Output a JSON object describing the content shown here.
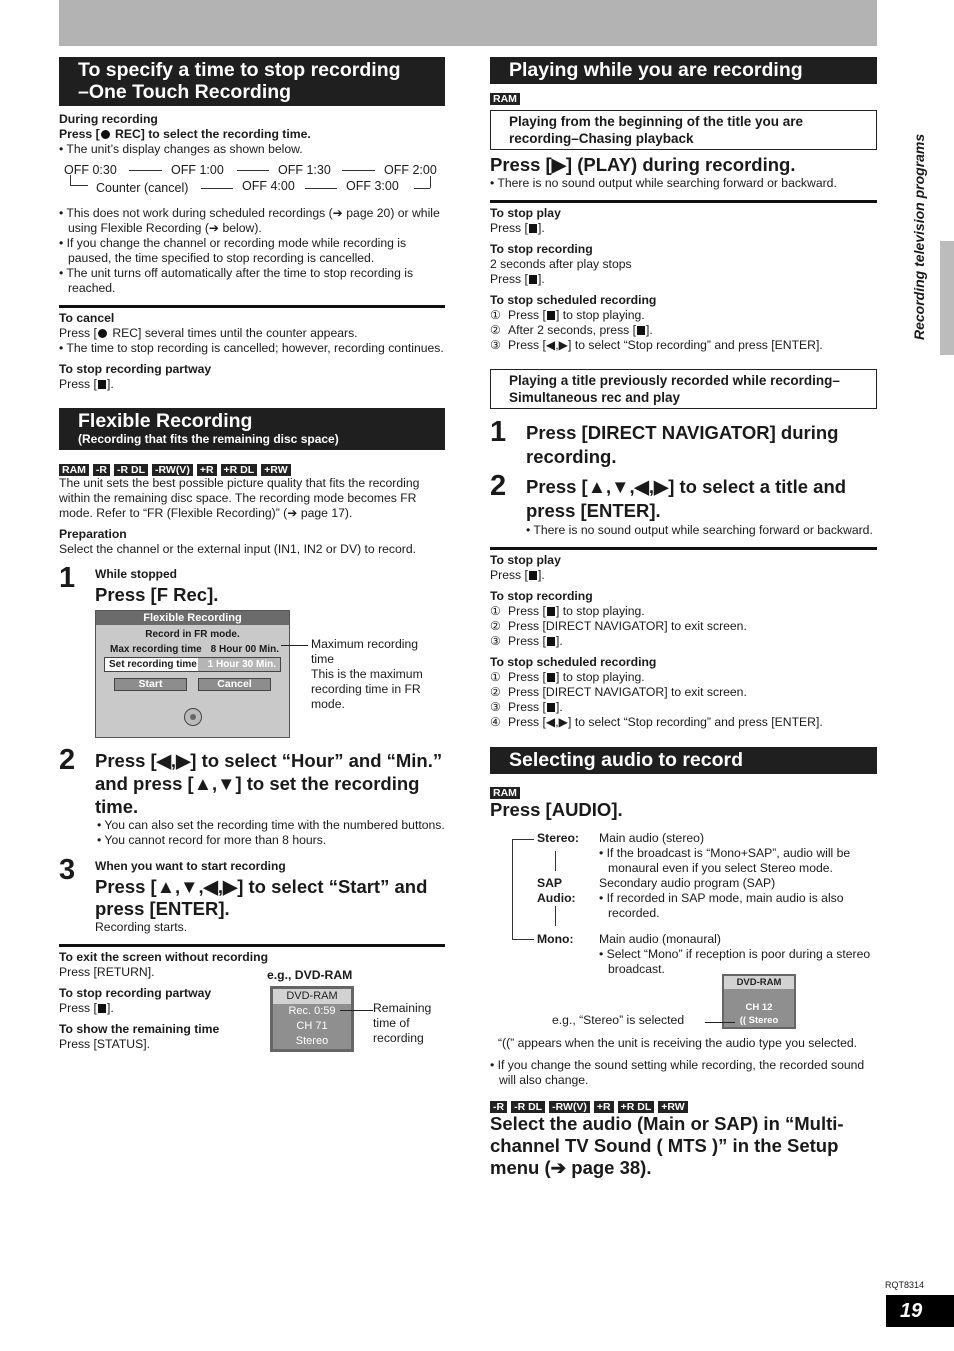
{
  "page": {
    "side_label": "Recording television programs",
    "doc_code": "RQT8314",
    "page_number": "19"
  },
  "one_touch": {
    "title_line1": "To specify a time to stop recording",
    "title_line2": "–One Touch Recording",
    "during": "During recording",
    "press_pre": "Press [",
    "press_post": " REC] to select the recording time.",
    "display_note": "• The unit’s display changes as shown below.",
    "cycle": {
      "off_030": "OFF 0:30",
      "off_100": "OFF 1:00",
      "off_130": "OFF 1:30",
      "off_200": "OFF 2:00",
      "counter": "Counter (cancel)",
      "off_400": "OFF 4:00",
      "off_300": "OFF 3:00"
    },
    "notes": [
      "• This does not work during scheduled recordings (➔ page 20) or while using Flexible Recording (➔ below).",
      "• If you change the channel or recording mode while recording is paused, the time specified to stop recording is cancelled.",
      "• The unit turns off automatically after the time to stop recording is reached."
    ],
    "cancel_head": "To cancel",
    "cancel_pre": "Press [",
    "cancel_post": " REC] several times until the counter appears.",
    "cancel_note": "• The time to stop recording is cancelled; however, recording continues.",
    "partway_head": "To stop recording partway",
    "press_open": "Press [",
    "press_close": "]."
  },
  "flexible": {
    "title": "Flexible Recording",
    "subtitle": "(Recording that fits the remaining disc space)",
    "discs": [
      "RAM",
      "-R",
      "-R DL",
      "-RW(V)",
      "+R",
      "+R DL",
      "+RW"
    ],
    "intro": "The unit sets the best possible picture quality that fits the recording within the remaining disc space. The recording mode becomes FR mode. Refer to “FR (Flexible Recording)” (➔ page 17).",
    "prep_head": "Preparation",
    "prep_text": "Select the channel or the external input (IN1, IN2 or DV) to record.",
    "step1_num": "1",
    "step1_pre": "While stopped",
    "step1_main": "Press [F Rec].",
    "osd": {
      "title": "Flexible Recording",
      "mode": "Record in FR mode.",
      "max_label": "Max recording time",
      "max_value": "8 Hour 00 Min.",
      "set_label": "Set recording time",
      "set_value": "1 Hour 30 Min.",
      "start": "Start",
      "cancel": "Cancel"
    },
    "osd_callout_1": "Maximum recording time",
    "osd_callout_2": "This is the maximum recording time in FR mode.",
    "step2_num": "2",
    "step2_main": "Press [◀,▶] to select “Hour” and “Min.” and press [▲,▼] to set the recording time.",
    "step2_notes": [
      "• You can also set the recording time with the numbered buttons.",
      "• You cannot record for more than 8 hours."
    ],
    "step3_num": "3",
    "step3_pre": "When you want to start recording",
    "step3_main": "Press [▲,▼,◀,▶] to select “Start” and press [ENTER].",
    "step3_note": "Recording starts.",
    "exit_head": "To exit the screen without recording",
    "exit_text": "Press [RETURN].",
    "partway_head": "To stop recording partway",
    "remaining_head": "To show the remaining time",
    "remaining_text": "Press [STATUS].",
    "eg_label": "e.g., DVD-RAM",
    "status_osd": [
      "DVD-RAM",
      "Rec. 0:59",
      "CH 71",
      "Stereo"
    ],
    "status_callout": "Remaining time of recording"
  },
  "playing": {
    "title": "Playing while you are recording",
    "disc": "RAM",
    "chase_box": "Playing from the beginning of the title you are recording–Chasing playback",
    "chase_main": "Press [▶] (PLAY) during recording.",
    "chase_note": "• There is no sound output while searching forward or backward.",
    "stop_play_head": "To stop play",
    "stop_rec_head": "To stop recording",
    "stop_rec_text": "2 seconds after play stops",
    "stop_sched_head": "To stop scheduled recording",
    "sched_steps": [
      {
        "n": "①",
        "pre": "Press [",
        "post": "] to stop playing."
      },
      {
        "n": "②",
        "pre": "After 2 seconds, press [",
        "post": "]."
      },
      {
        "n": "③",
        "pre": "Press [◀,▶] to select “Stop recording” and press [ENTER].",
        "post": ""
      }
    ],
    "simul_box": "Playing a title previously recorded while recording–Simultaneous rec and play",
    "s1_num": "1",
    "s1_main": "Press [DIRECT NAVIGATOR] during recording.",
    "s2_num": "2",
    "s2_main": "Press [▲,▼,◀,▶] to select a title and press [ENTER].",
    "s2_note": "• There is no sound output while searching forward or backward.",
    "simul_stop_rec": [
      {
        "n": "①",
        "pre": "Press [",
        "post": "] to stop playing."
      },
      {
        "n": "②",
        "pre": "Press [DIRECT NAVIGATOR] to exit screen.",
        "post": ""
      },
      {
        "n": "③",
        "pre": "Press [",
        "post": "]."
      }
    ],
    "simul_stop_sched": [
      {
        "n": "①",
        "pre": "Press [",
        "post": "] to stop playing."
      },
      {
        "n": "②",
        "pre": "Press [DIRECT NAVIGATOR] to exit screen.",
        "post": ""
      },
      {
        "n": "③",
        "pre": "Press [",
        "post": "]."
      },
      {
        "n": "④",
        "pre": "Press [◀,▶] to select “Stop recording” and press [ENTER].",
        "post": ""
      }
    ]
  },
  "audio": {
    "title": "Selecting audio to record",
    "disc": "RAM",
    "main": "Press [AUDIO].",
    "stereo_label": "Stereo:",
    "stereo_desc": "Main audio (stereo)",
    "stereo_note": "• If the broadcast is “Mono+SAP”, audio will be monaural even if you select Stereo mode.",
    "sap_label_1": "SAP",
    "sap_label_2": "Audio:",
    "sap_desc": "Secondary audio program (SAP)",
    "sap_note": "• If recorded in SAP mode, main audio is also recorded.",
    "mono_label": "Mono:",
    "mono_desc": "Main audio (monaural)",
    "mono_note": "• Select “Mono” if reception is poor during a stereo broadcast.",
    "eg_label": "e.g., “Stereo” is selected",
    "osd": [
      "DVD-RAM",
      "CH 12",
      "(( Stereo"
    ],
    "receiving_note": "“((” appears when the unit is receiving the audio type you selected.",
    "change_note": "• If you change the sound setting while recording, the recorded sound will also change.",
    "discs2": [
      "-R",
      "-R DL",
      "-RW(V)",
      "+R",
      "+R DL",
      "+RW"
    ],
    "mts_main": "Select the audio (Main or SAP) in “Multi-channel TV Sound ( MTS )” in the Setup menu (➔ page 38)."
  }
}
